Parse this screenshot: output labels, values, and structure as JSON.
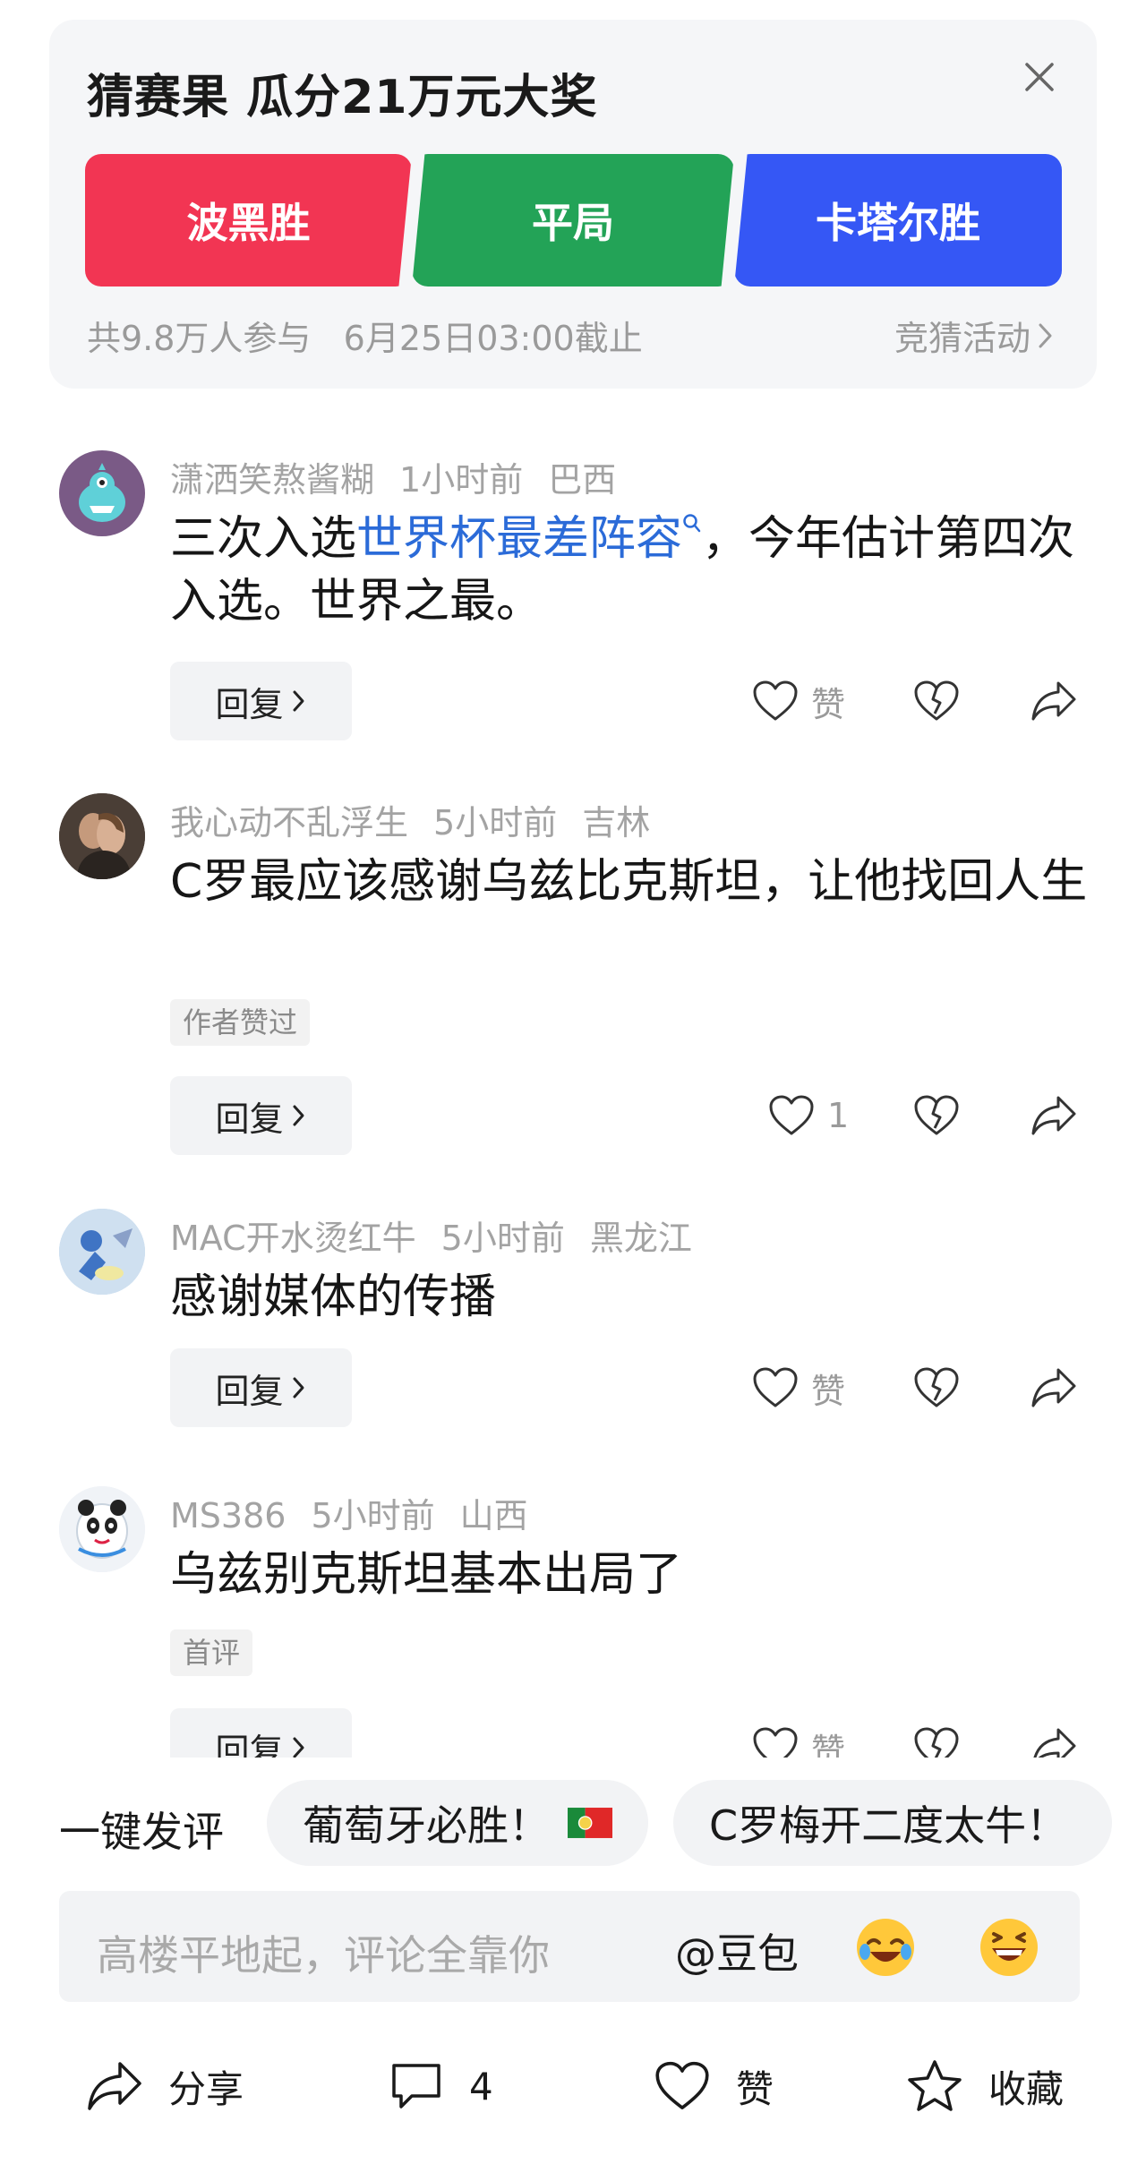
{
  "guess": {
    "title": "猜赛果 瓜分21万元大奖",
    "options": [
      "波黑胜",
      "平局",
      "卡塔尔胜"
    ],
    "meta": "共9.8万人参与   6月25日03:00截止",
    "link_label": "竞猜活动"
  },
  "comments": [
    {
      "user": "潇洒笑熬酱糊",
      "time": "1小时前",
      "location": "巴西",
      "text_before": "三次入选",
      "text_link": "世界杯最差阵容",
      "text_after": "，今年估计第四次入选。世界之最。",
      "reply_label": "回复",
      "like_label": "赞"
    },
    {
      "user": "我心动不乱浮生",
      "time": "5小时前",
      "location": "吉林",
      "text": "C罗最应该感谢乌兹比克斯坦，让他找回人生",
      "tag": "作者赞过",
      "reply_label": "回复",
      "like_label": "1"
    },
    {
      "user": "MAC开水烫红牛",
      "time": "5小时前",
      "location": "黑龙江",
      "text": "感谢媒体的传播",
      "reply_label": "回复",
      "like_label": "赞"
    },
    {
      "user": "MS386",
      "time": "5小时前",
      "location": "山西",
      "text": "乌兹别克斯坦基本出局了",
      "tag": "首评",
      "reply_label": "回复",
      "like_label": "赞"
    }
  ],
  "quick_comment": {
    "label": "一键发评",
    "chips": [
      "葡萄牙必胜！",
      "C罗梅开二度太牛！"
    ]
  },
  "input": {
    "placeholder": "高楼平地起，评论全靠你",
    "mention": "@豆包"
  },
  "bottom_bar": {
    "share": "分享",
    "comments": "4",
    "like": "赞",
    "favorite": "收藏"
  },
  "colors": {
    "option_red": "#f23553",
    "option_green": "#23a357",
    "option_blue": "#3557f5",
    "link_blue": "#2b6bd8"
  },
  "icons": [
    "close-icon",
    "chevron-right-icon",
    "search-icon",
    "heart-icon",
    "broken-heart-icon",
    "share-arrow-icon",
    "portugal-flag-icon",
    "laughing-emoji-icon",
    "grinning-emoji-icon",
    "comment-icon",
    "star-icon"
  ]
}
